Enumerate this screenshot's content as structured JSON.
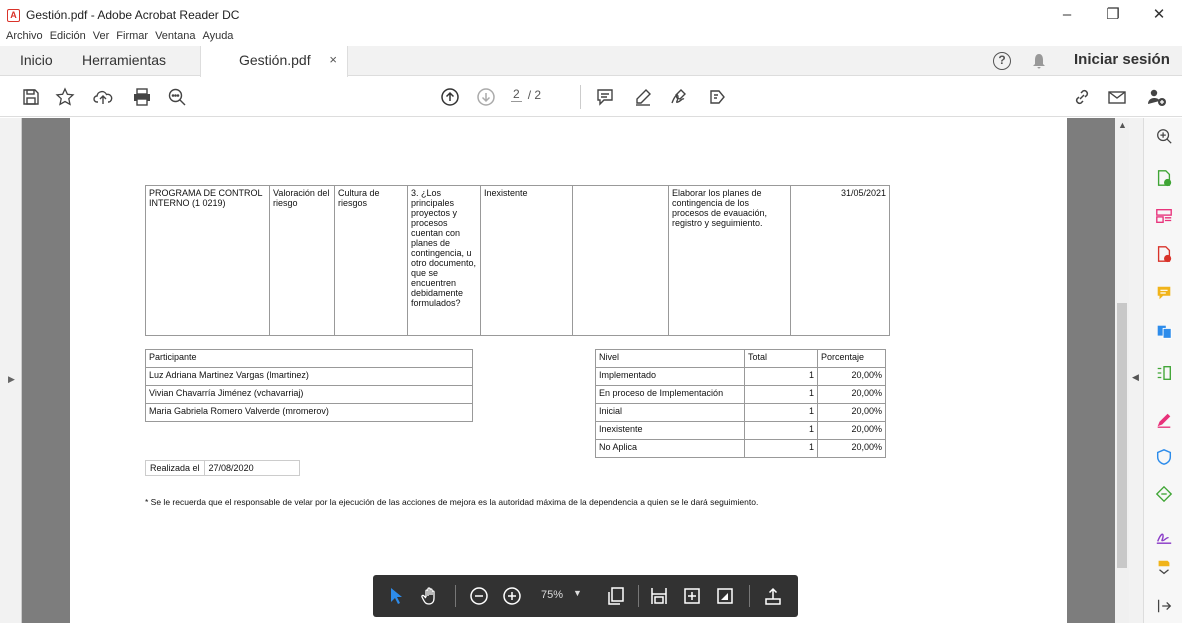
{
  "window": {
    "title": "Gestión.pdf - Adobe Acrobat Reader DC",
    "minimize": "–",
    "restore": "❐",
    "close": "✕"
  },
  "menu": [
    "Archivo",
    "Edición",
    "Ver",
    "Firmar",
    "Ventana",
    "Ayuda"
  ],
  "tabs": {
    "home": "Inicio",
    "tools": "Herramientas",
    "document": "Gestión.pdf",
    "close": "×",
    "signin": "Iniciar sesión",
    "help": "?"
  },
  "toolbar": {
    "page_current": "2",
    "page_total": "/ 2"
  },
  "document": {
    "main_row": {
      "programa": "PROGRAMA DE CONTROL INTERNO (1 0219)",
      "componente": "Valoración del riesgo",
      "eje": "Cultura de riesgos",
      "pregunta": "3. ¿Los principales proyectos y procesos cuentan con planes de contingencia, u otro documento, que se encuentren debidamente formulados?",
      "nivel": "Inexistente",
      "vacio": "",
      "accion": "Elaborar los planes de contingencia de los procesos de evauación, registro y seguimiento.",
      "fecha": "31/05/2021"
    },
    "participantes": {
      "header": "Participante",
      "rows": [
        "Luz Adriana Martinez Vargas (lmartinez)",
        "Vivian Chavarría Jiménez (vchavarriaj)",
        "Maria Gabriela Romero Valverde (mromerov)"
      ]
    },
    "niveles": {
      "headers": [
        "Nivel",
        "Total",
        "Porcentaje"
      ],
      "rows": [
        {
          "nivel": "Implementado",
          "total": "1",
          "pct": "20,00%"
        },
        {
          "nivel": "En proceso de Implementación",
          "total": "1",
          "pct": "20,00%"
        },
        {
          "nivel": "Inicial",
          "total": "1",
          "pct": "20,00%"
        },
        {
          "nivel": "Inexistente",
          "total": "1",
          "pct": "20,00%"
        },
        {
          "nivel": "No Aplica",
          "total": "1",
          "pct": "20,00%"
        }
      ]
    },
    "realizada_label": "Realizada el",
    "realizada_fecha": "27/08/2020",
    "nota": "* Se le recuerda que el responsable de velar por la ejecución de las acciones de mejora es la autoridad máxima de la dependencia a quien se le dará seguimiento."
  },
  "floatbar": {
    "zoom": "75%"
  },
  "colors": {
    "accent_blue": "#2d8ceb",
    "rail_green": "#3fa535",
    "rail_red": "#d9332a",
    "rail_yellow": "#f1b41a",
    "rail_purple": "#8c3ec8",
    "rail_pink": "#e8317a"
  }
}
